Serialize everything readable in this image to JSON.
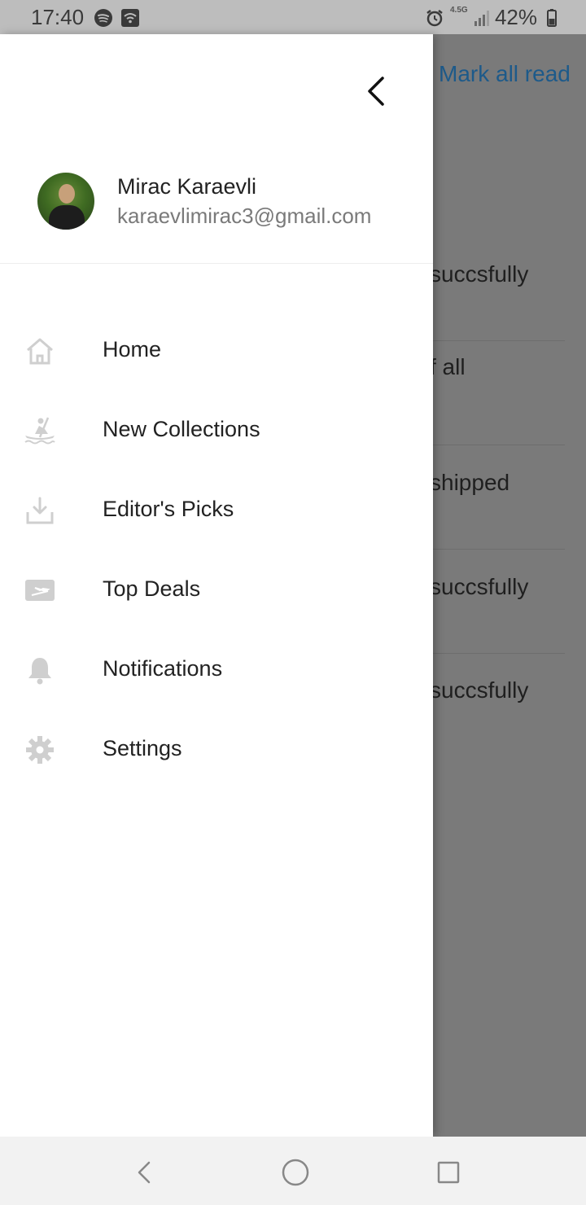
{
  "status_bar": {
    "time": "17:40",
    "network": "4.5G",
    "battery": "42%"
  },
  "background": {
    "mark_all_read": "Mark all read",
    "rows": [
      "succsfully",
      "f all",
      "shipped",
      "succsfully",
      "succsfully"
    ]
  },
  "drawer": {
    "profile": {
      "name": "Mirac Karaevli",
      "email": "karaevlimirac3@gmail.com"
    },
    "menu": [
      {
        "label": "Home",
        "icon": "home-icon"
      },
      {
        "label": "New Collections",
        "icon": "kayak-icon"
      },
      {
        "label": "Editor's Picks",
        "icon": "download-tray-icon"
      },
      {
        "label": "Top Deals",
        "icon": "flight-ticket-icon"
      },
      {
        "label": "Notifications",
        "icon": "bell-icon"
      },
      {
        "label": "Settings",
        "icon": "gear-icon"
      }
    ]
  },
  "colors": {
    "link_blue": "#1d5a8a",
    "icon_gray": "#cfcfcf",
    "scrim": "#7a7a7a"
  }
}
